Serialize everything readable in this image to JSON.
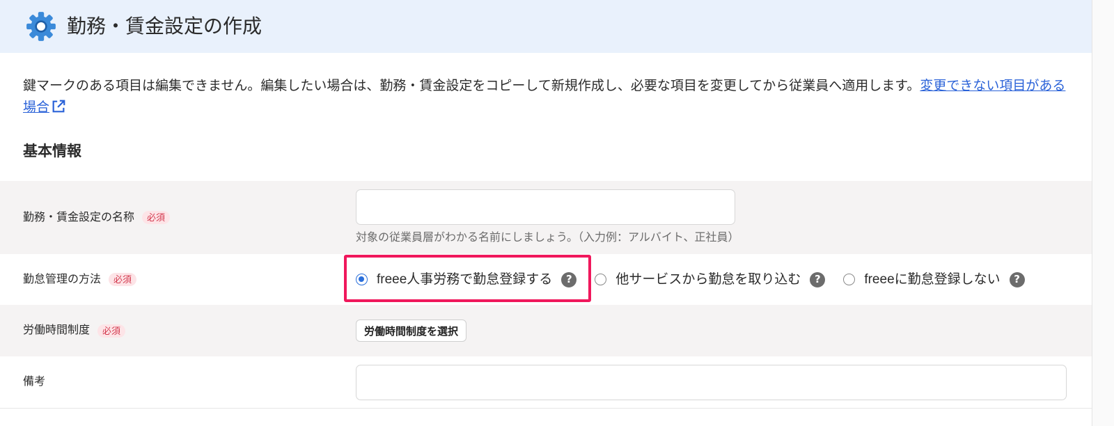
{
  "header": {
    "title": "勤務・賃金設定の作成",
    "icon": "gear-icon"
  },
  "notice": {
    "text": "鍵マークのある項目は編集できません。編集したい場合は、勤務・賃金設定をコピーして新規作成し、必要な項目を変更してから従業員へ適用します。",
    "link_label": "変更できない項目がある場合",
    "link_icon": "external-link-icon"
  },
  "section": {
    "title": "基本情報"
  },
  "form": {
    "name": {
      "label": "勤務・賃金設定の名称",
      "required_label": "必須",
      "value": "",
      "hint": "対象の従業員層がわかる名前にしましょう。（入力例：アルバイト、正社員）"
    },
    "attendance": {
      "label": "勤怠管理の方法",
      "required_label": "必須",
      "help_icon": "question-icon",
      "options": [
        {
          "label": "freee人事労務で勤怠登録する",
          "selected": true
        },
        {
          "label": "他サービスから勤怠を取り込む",
          "selected": false
        },
        {
          "label": "freeeに勤怠登録しない",
          "selected": false
        }
      ]
    },
    "work_system": {
      "label": "労働時間制度",
      "required_label": "必須",
      "button_label": "労働時間制度を選択"
    },
    "remarks": {
      "label": "備考",
      "value": ""
    }
  },
  "colors": {
    "header-bg": "#e9f1fc",
    "row-alt": "#f5f3f3",
    "link": "#2a62d8",
    "accent": "#2a6fdb",
    "badge-bg": "#fde4e7",
    "badge-text": "#d33a4f",
    "highlight": "#f0185c",
    "help": "#6c6c6c",
    "gear": "#3b8ad9",
    "gear-dark": "#1f5fa8"
  }
}
